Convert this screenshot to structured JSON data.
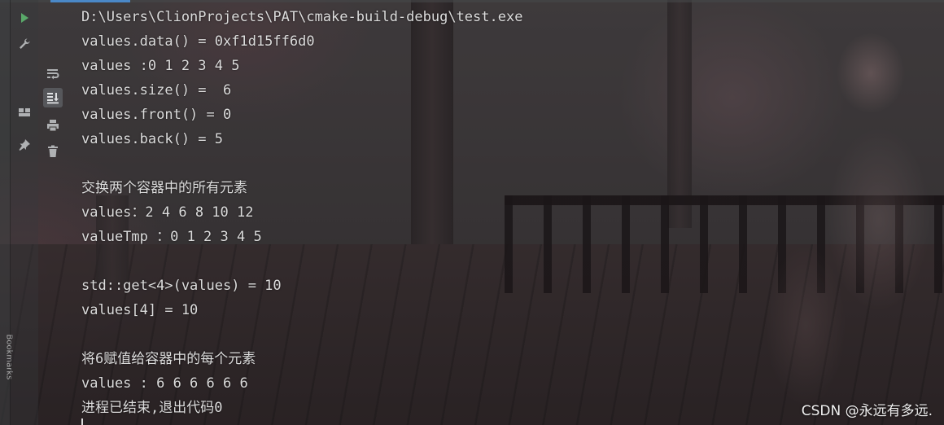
{
  "console": {
    "lines": [
      "D:\\Users\\ClionProjects\\PAT\\cmake-build-debug\\test.exe",
      "values.data() = 0xf1d15ff6d0",
      "values :0 1 2 3 4 5",
      "values.size() =  6",
      "values.front() = 0",
      "values.back() = 5",
      "",
      "交换两个容器中的所有元素",
      "values：2 4 6 8 10 12",
      "valueTmp ：0 1 2 3 4 5",
      "",
      "std::get<4>(values) = 10",
      "values[4] = 10",
      "",
      "将6赋值给容器中的每个元素",
      "values : 6 6 6 6 6 6",
      "进程已结束,退出代码0"
    ]
  },
  "left_strip": {
    "bookmarks_label": "Bookmarks"
  },
  "toolbar": {
    "run_icon": "play-icon",
    "settings_icon": "wrench-icon",
    "layout_icon": "layout-icon",
    "pin_icon": "pin-icon",
    "soft_wrap_icon": "soft-wrap-icon",
    "scroll_to_end_icon": "scroll-to-end-icon",
    "print_icon": "print-icon",
    "clear_icon": "trash-icon"
  },
  "watermark": {
    "text": "CSDN @永远有多远."
  },
  "colors": {
    "run_green": "#59a869",
    "icon_gray": "#afb1b3",
    "accent_blue": "#4a88c7",
    "console_text": "#dcdcdc"
  }
}
